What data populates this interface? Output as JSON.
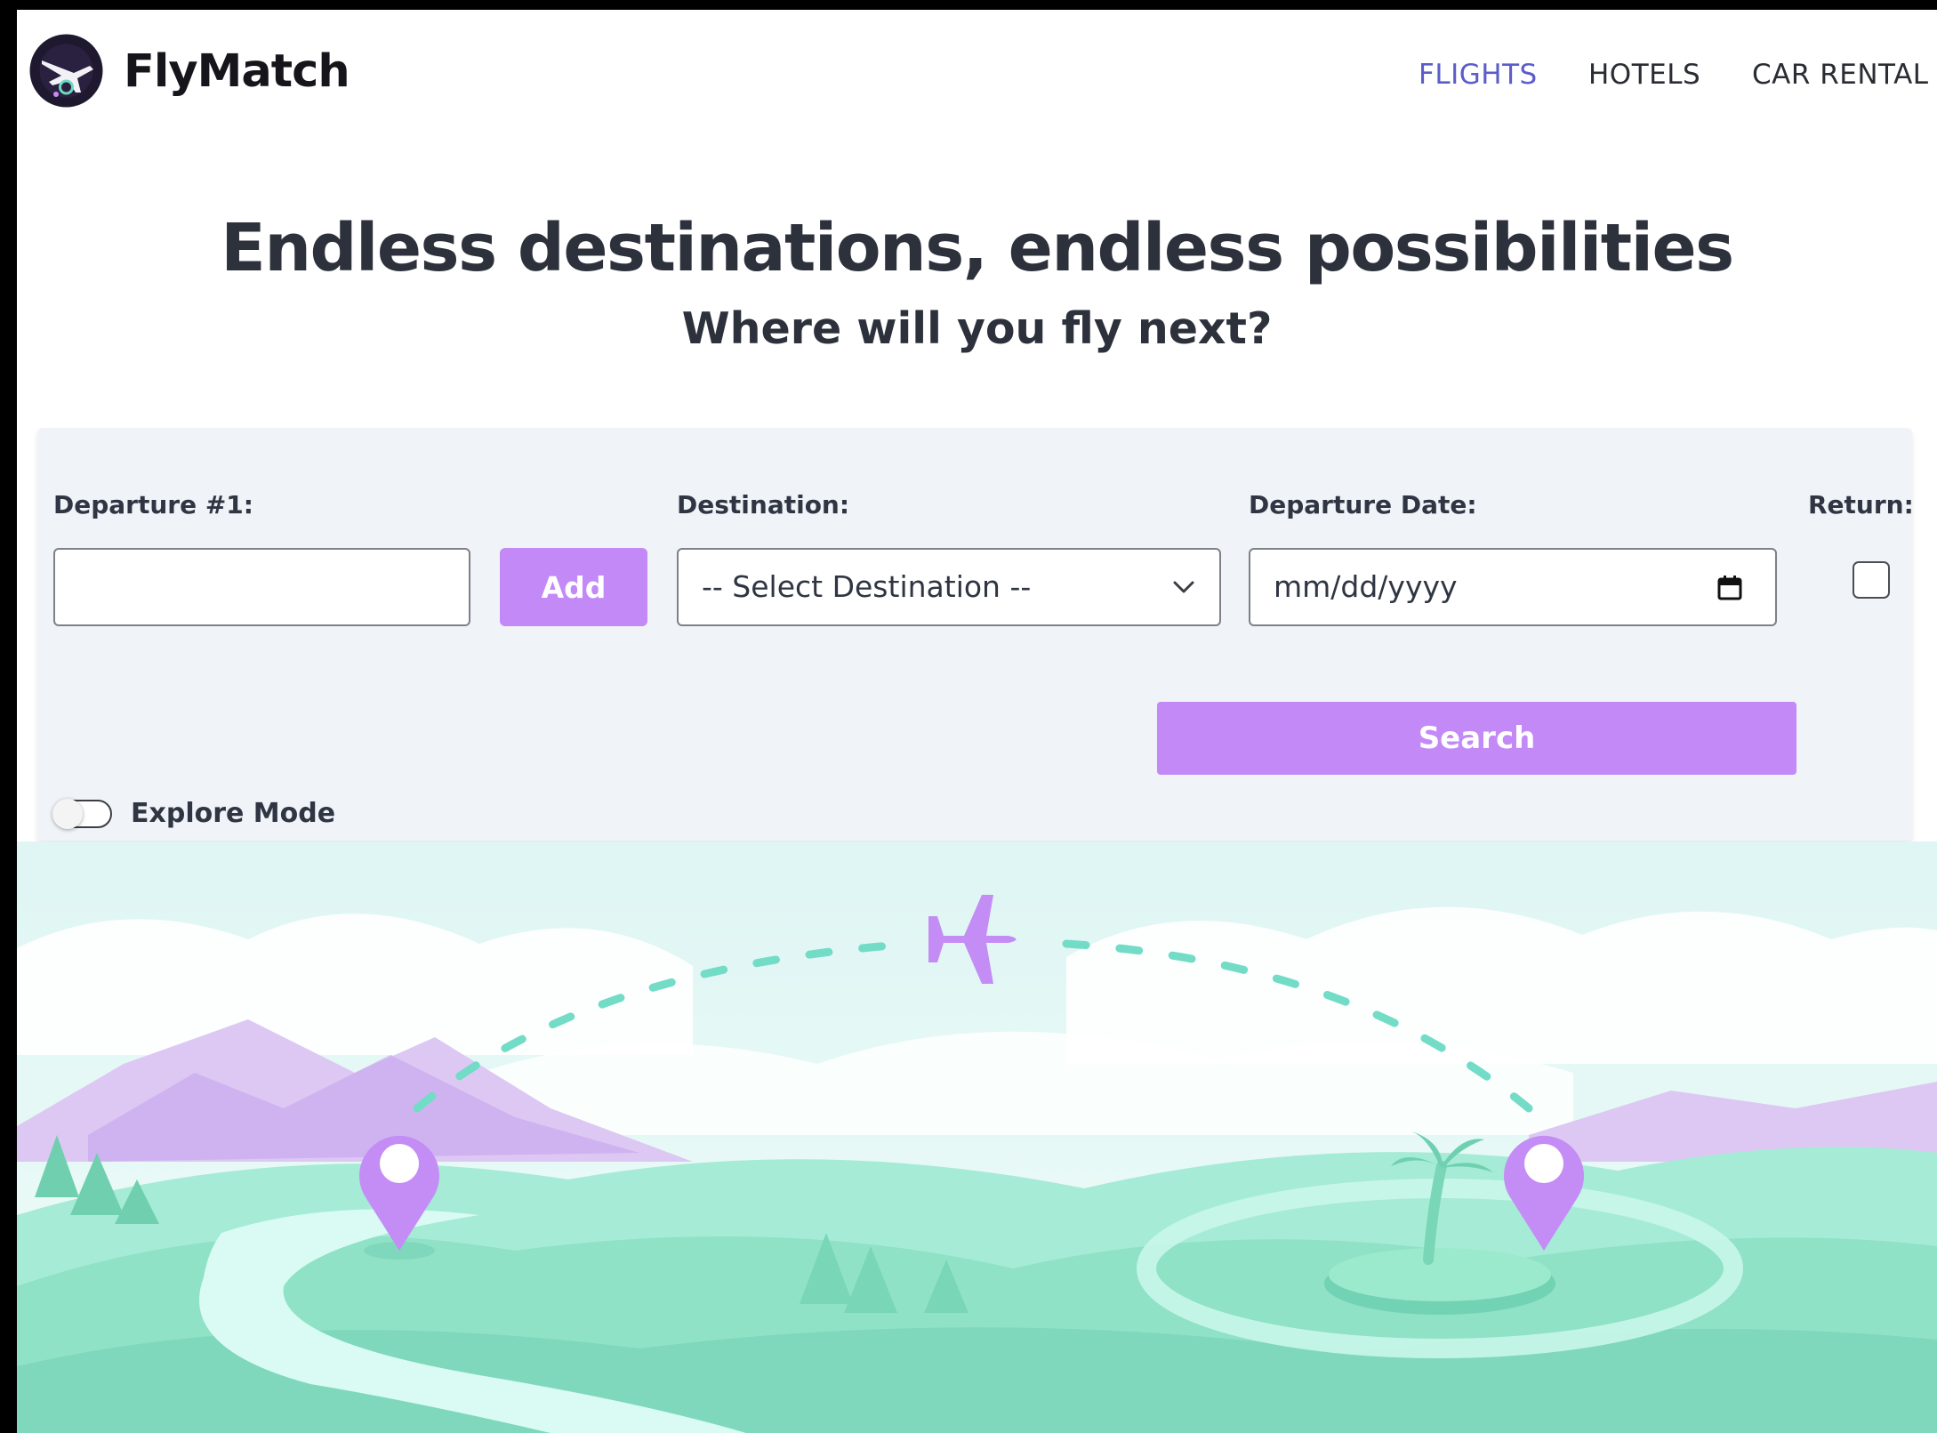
{
  "header": {
    "brand": "FlyMatch",
    "logo_icon": "airplane-logo-icon",
    "nav": [
      {
        "label": "FLIGHTS",
        "active": true
      },
      {
        "label": "HOTELS",
        "active": false
      },
      {
        "label": "CAR RENTAL",
        "active": false
      }
    ]
  },
  "hero": {
    "title": "Endless destinations, endless possibilities",
    "subtitle": "Where will you fly next?"
  },
  "search_form": {
    "departure_label": "Departure #1:",
    "departure_value": "",
    "add_label": "Add",
    "destination_label": "Destination:",
    "destination_selected": "-- Select Destination --",
    "departure_date_label": "Departure Date:",
    "departure_date_placeholder": "mm/dd/yyyy",
    "return_label": "Return:",
    "return_checked": false,
    "search_label": "Search",
    "explore_mode_label": "Explore Mode",
    "explore_mode_on": false
  },
  "colors": {
    "accent": "#c389f7",
    "nav_active": "#5b5dc9",
    "panel_bg": "#f0f3f8",
    "landscape_green": "#8fe6c8",
    "landscape_purple": "#c99af2"
  },
  "illustration": {
    "icons": [
      "airplane-icon",
      "map-pin-icon",
      "palm-tree-icon"
    ]
  }
}
